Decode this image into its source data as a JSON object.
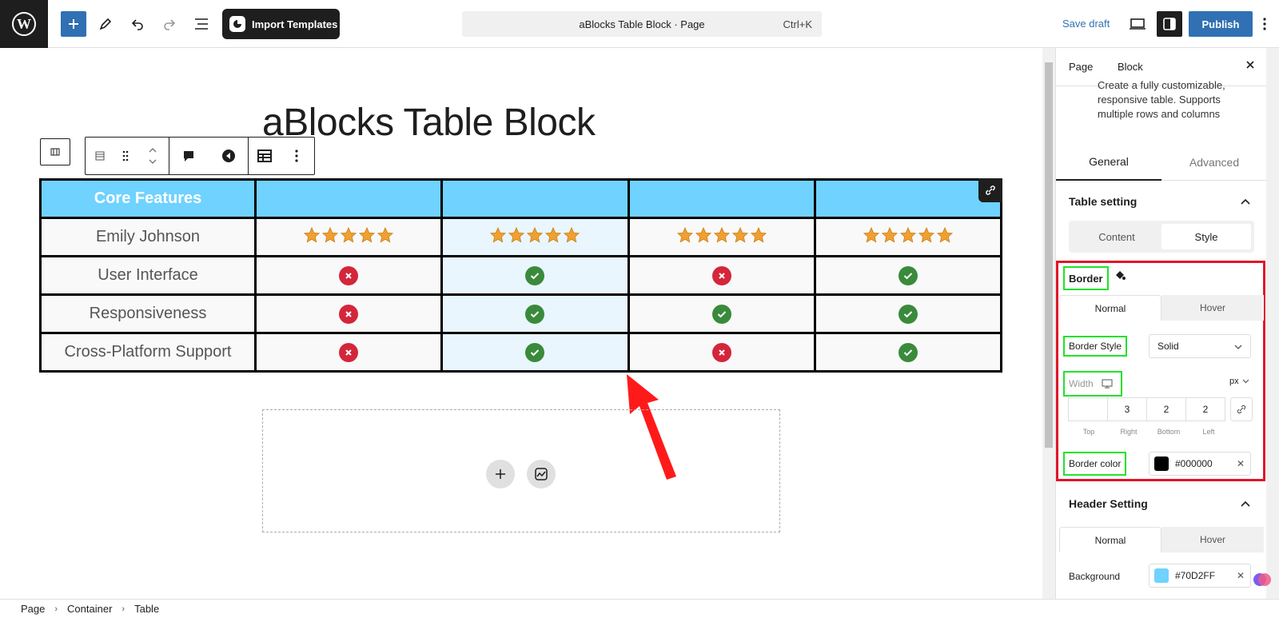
{
  "topbar": {
    "import_label": "Import Templates",
    "doc_title": "aBlocks Table Block · Page",
    "shortcut": "Ctrl+K",
    "save_draft": "Save draft",
    "publish": "Publish"
  },
  "canvas": {
    "page_title": "aBlocks Table Block"
  },
  "table": {
    "header": [
      "Core Features",
      "",
      "",
      "",
      ""
    ],
    "rows": [
      {
        "feature": "Emily Johnson",
        "cells": [
          "stars",
          "stars",
          "stars",
          "stars"
        ]
      },
      {
        "feature": "User Interface",
        "cells": [
          "no",
          "ok",
          "no",
          "ok"
        ]
      },
      {
        "feature": "Responsiveness",
        "cells": [
          "no",
          "ok",
          "ok",
          "ok"
        ]
      },
      {
        "feature": "Cross-Platform Support",
        "cells": [
          "no",
          "ok",
          "no",
          "ok"
        ]
      }
    ],
    "star_count": 5,
    "colors": {
      "header_bg": "#70D2FF",
      "star": "#f0a030",
      "ok": "#3a8a3c",
      "no": "#d3263b",
      "border": "#000000"
    }
  },
  "breadcrumb": [
    "Page",
    "Container",
    "Table"
  ],
  "sidebar": {
    "tab_page": "Page",
    "tab_block": "Block",
    "description": "Create a fully customizable, responsive table. Supports multiple rows and columns",
    "tab_general": "General",
    "tab_advanced": "Advanced",
    "table_setting": "Table setting",
    "content": "Content",
    "style": "Style",
    "border": {
      "title": "Border",
      "normal": "Normal",
      "hover": "Hover",
      "style_label": "Border Style",
      "style_value": "Solid",
      "width_label": "Width",
      "unit": "px",
      "top": "",
      "right": "3",
      "bottom": "2",
      "left": "2",
      "top_label": "Top",
      "right_label": "Right",
      "bottom_label": "Bottom",
      "left_label": "Left",
      "color_label": "Border color",
      "color_value": "#000000"
    },
    "header_setting": {
      "title": "Header Setting",
      "normal": "Normal",
      "hover": "Hover",
      "background_label": "Background",
      "background_value": "#70D2FF"
    }
  }
}
